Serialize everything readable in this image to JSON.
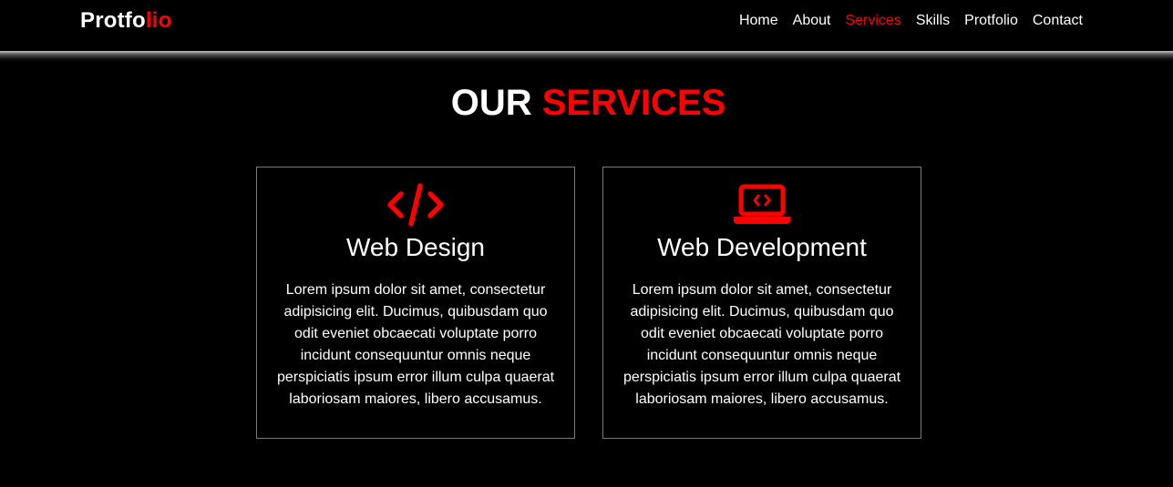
{
  "brand": {
    "logo_main": "Protfo",
    "logo_accent": "lio",
    "accent_color": "#ff0000",
    "background": "#000000"
  },
  "nav": {
    "items": [
      {
        "label": "Home",
        "active": false
      },
      {
        "label": "About",
        "active": false
      },
      {
        "label": "Services",
        "active": true
      },
      {
        "label": "Skills",
        "active": false
      },
      {
        "label": "Protfolio",
        "active": false
      },
      {
        "label": "Contact",
        "active": false
      }
    ]
  },
  "services": {
    "title_main": "OUR",
    "title_accent": "SERVICES",
    "cards": [
      {
        "icon": "code-icon",
        "title": "Web Design",
        "text": "Lorem ipsum dolor sit amet, consectetur adipisicing elit. Ducimus, quibusdam quo odit eveniet obcaecati voluptate porro incidunt consequuntur omnis neque perspiciatis ipsum error illum culpa quaerat laboriosam maiores, libero accusamus."
      },
      {
        "icon": "laptop-code-icon",
        "title": "Web Development",
        "text": "Lorem ipsum dolor sit amet, consectetur adipisicing elit. Ducimus, quibusdam quo odit eveniet obcaecati voluptate porro incidunt consequuntur omnis neque perspiciatis ipsum error illum culpa quaerat laboriosam maiores, libero accusamus."
      }
    ]
  }
}
